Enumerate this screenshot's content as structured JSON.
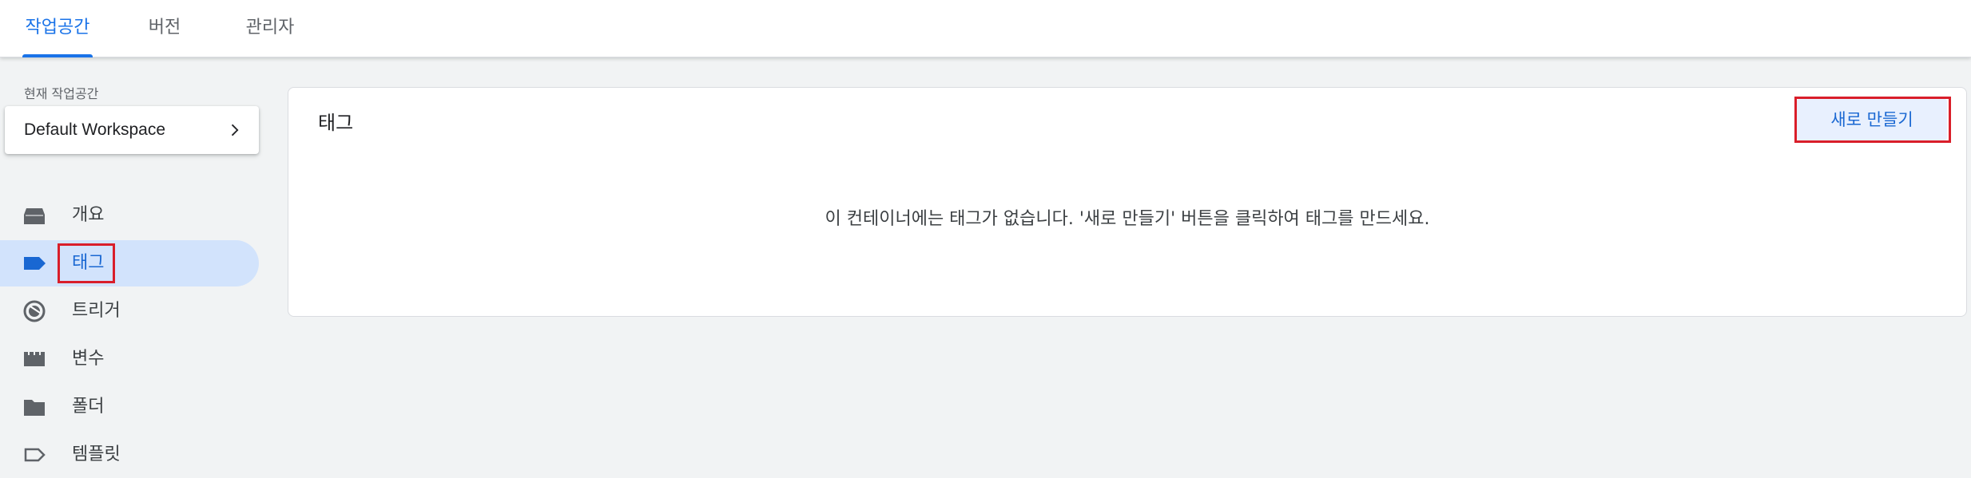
{
  "tabs": [
    {
      "label": "작업공간",
      "active": true
    },
    {
      "label": "버전",
      "active": false
    },
    {
      "label": "관리자",
      "active": false
    }
  ],
  "sidebar": {
    "workspace_label": "현재 작업공간",
    "workspace_name": "Default Workspace",
    "items": [
      {
        "label": "개요",
        "icon": "overview-icon"
      },
      {
        "label": "태그",
        "icon": "tag-icon",
        "active": true
      },
      {
        "label": "트리거",
        "icon": "trigger-icon"
      },
      {
        "label": "변수",
        "icon": "variables-icon"
      },
      {
        "label": "폴더",
        "icon": "folder-icon"
      },
      {
        "label": "템플릿",
        "icon": "template-icon"
      }
    ]
  },
  "main": {
    "title": "태그",
    "new_button": "새로 만들기",
    "empty_message": "이 컨테이너에는 태그가 없습니다. '새로 만들기' 버튼을 클릭하여 태그를 만드세요."
  },
  "colors": {
    "accent": "#1a73e8",
    "active_nav_bg": "#d2e3fc",
    "button_bg": "#e8f0fe",
    "highlight_box": "#d91e2a",
    "page_bg": "#f1f3f4"
  }
}
